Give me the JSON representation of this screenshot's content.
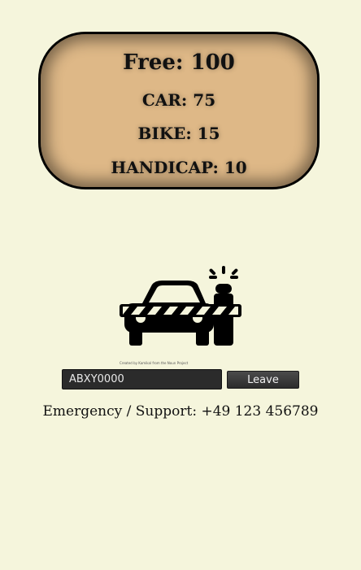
{
  "capacity": {
    "free": "Free: 100",
    "car": "CAR: 75",
    "bike": "BIKE: 15",
    "handicap": "HANDICAP: 10"
  },
  "logo": {
    "icon": "car-at-barrier-with-siren-icon",
    "credit": "Created by Kamikal from the Noun Project"
  },
  "plate_form": {
    "plate_value": "ABXY0000",
    "leave_label": "Leave"
  },
  "support": {
    "text": "Emergency / Support: +49 123 456789"
  },
  "colors": {
    "page_bg": "#f5f5dc",
    "panel_bg": "#deb887",
    "button_bg": "#3a3a3a"
  }
}
